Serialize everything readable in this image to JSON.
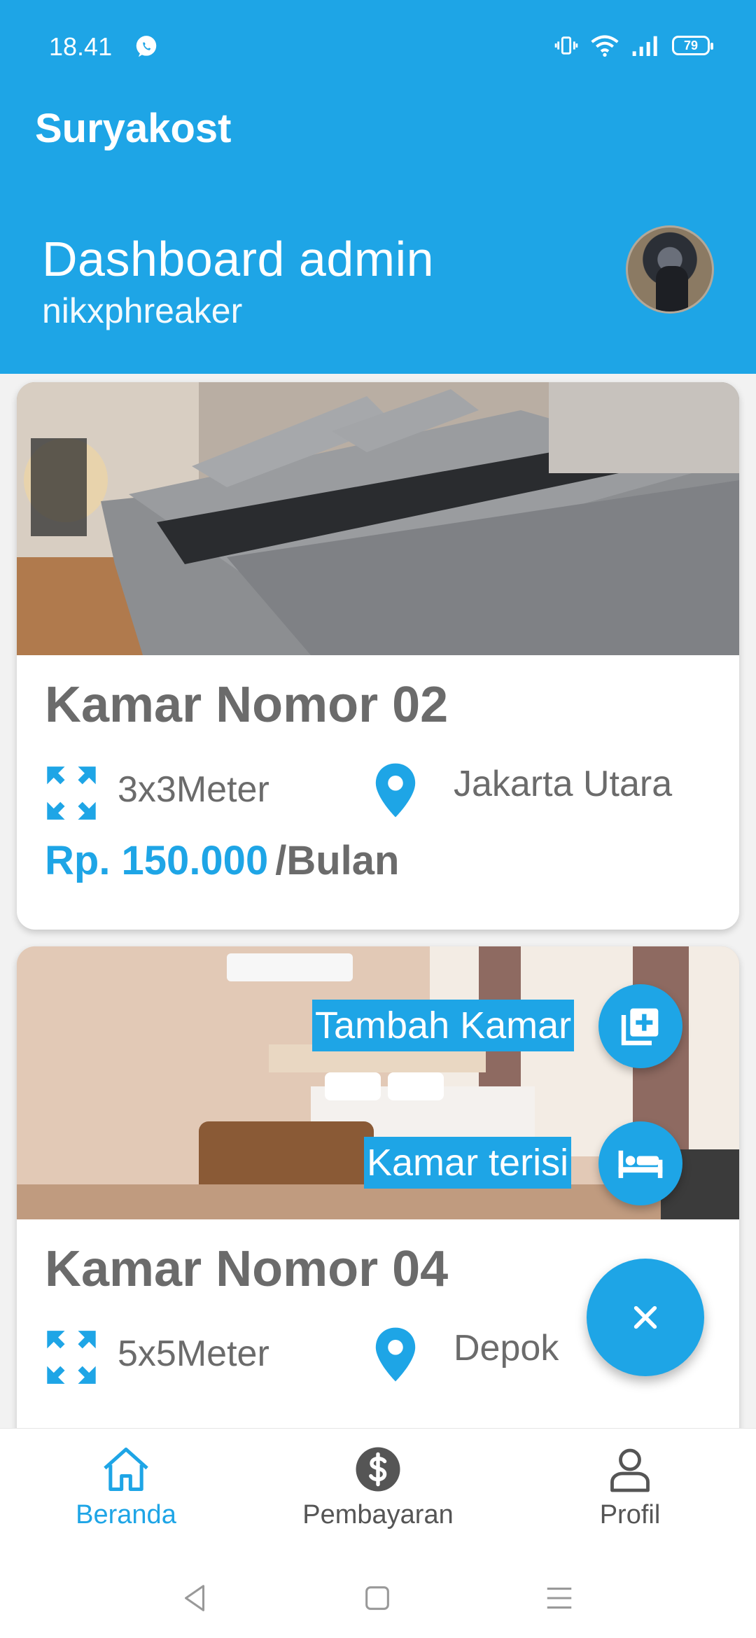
{
  "status_bar": {
    "time": "18.41",
    "battery": "79"
  },
  "app": {
    "title": "Suryakost"
  },
  "dashboard": {
    "title": "Dashboard admin",
    "username": "nikxphreaker"
  },
  "rooms": [
    {
      "title": "Kamar Nomor 02",
      "size": "3x3Meter",
      "location": "Jakarta Utara",
      "price": "Rp. 150.000",
      "price_unit": "/Bulan"
    },
    {
      "title": "Kamar Nomor 04",
      "size": "5x5Meter",
      "location": "Depok"
    }
  ],
  "fab_menu": {
    "add_room_label": "Tambah Kamar",
    "occupied_label": "Kamar terisi",
    "close_symbol": "×"
  },
  "bottom_nav": {
    "home": "Beranda",
    "payment": "Pembayaran",
    "profile": "Profil"
  },
  "colors": {
    "primary": "#1ea5e6",
    "text_gray": "#6b6b6b"
  }
}
